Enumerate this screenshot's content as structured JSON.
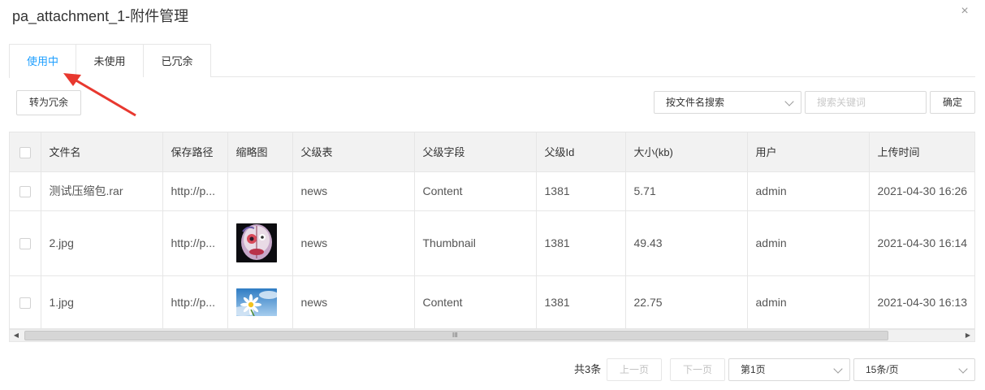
{
  "dialog": {
    "title": "pa_attachment_1-附件管理",
    "close_glyph": "×"
  },
  "tabs": [
    {
      "label": "使用中",
      "active": true
    },
    {
      "label": "未使用",
      "active": false
    },
    {
      "label": "已冗余",
      "active": false
    }
  ],
  "toolbar": {
    "redundant_button": "转为冗余",
    "search_mode": "按文件名搜索",
    "search_placeholder": "搜索关键词",
    "confirm_button": "确定"
  },
  "table": {
    "columns": [
      "文件名",
      "保存路径",
      "缩略图",
      "父级表",
      "父级字段",
      "父级Id",
      "大小(kb)",
      "用户",
      "上传时间"
    ],
    "rows": [
      {
        "filename": "测试压缩包.rar",
        "path": "http://p...",
        "thumbnail": "",
        "parent_table": "news",
        "parent_field": "Content",
        "parent_id": "1381",
        "size": "5.71",
        "user": "admin",
        "uploaded": "2021-04-30 16:26"
      },
      {
        "filename": "2.jpg",
        "path": "http://p...",
        "thumbnail": "portrait-image",
        "parent_table": "news",
        "parent_field": "Thumbnail",
        "parent_id": "1381",
        "size": "49.43",
        "user": "admin",
        "uploaded": "2021-04-30 16:14"
      },
      {
        "filename": "1.jpg",
        "path": "http://p...",
        "thumbnail": "daisy-sky-image",
        "parent_table": "news",
        "parent_field": "Content",
        "parent_id": "1381",
        "size": "22.75",
        "user": "admin",
        "uploaded": "2021-04-30 16:13"
      }
    ]
  },
  "scrollbar": {
    "left_glyph": "◀",
    "right_glyph": "▶",
    "grip_glyph": "III"
  },
  "pagination": {
    "total": "共3条",
    "prev": "上一页",
    "next": "下一页",
    "page": "第1页",
    "page_size": "15条/页"
  },
  "colors": {
    "accent": "#1e9fff",
    "annotation_arrow": "#e8382f"
  }
}
